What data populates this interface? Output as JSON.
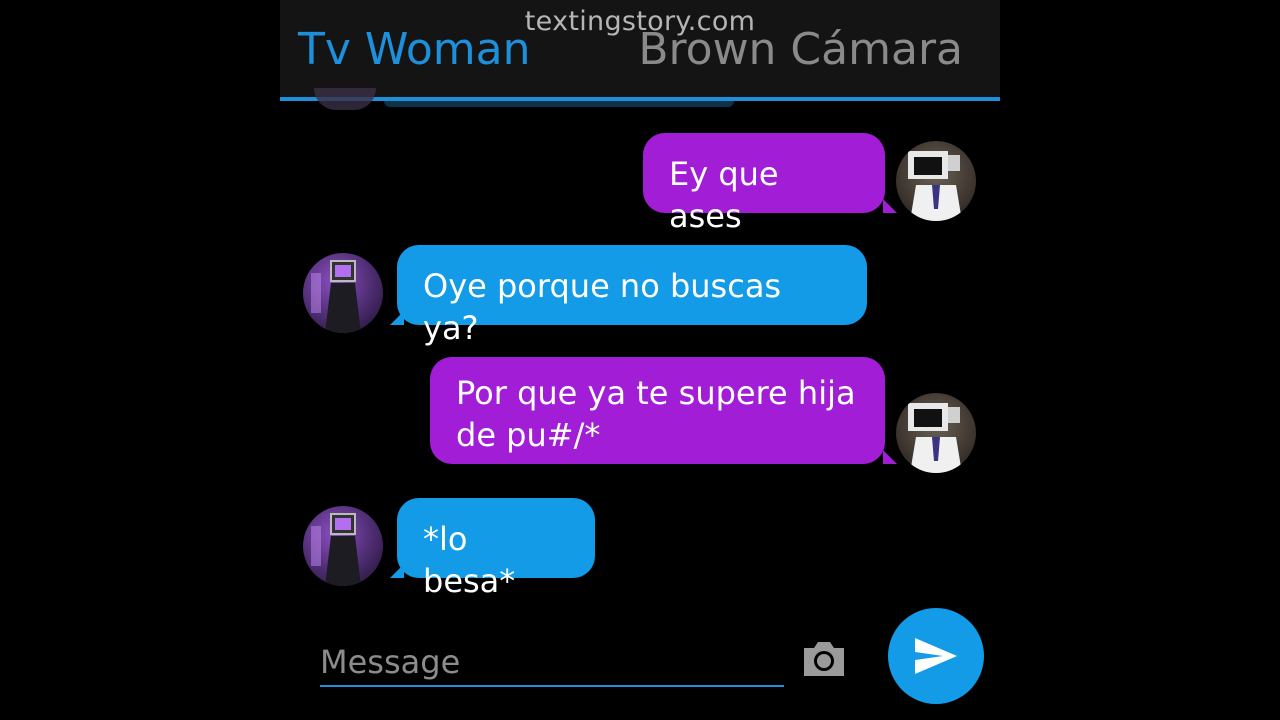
{
  "header": {
    "watermark": "textingstory.com",
    "contact_left": "Tv Woman",
    "contact_right": "Brown Cámara"
  },
  "messages": [
    {
      "side": "sent",
      "sender": "Brown Cámara",
      "text": "Ey que ases"
    },
    {
      "side": "recv",
      "sender": "Tv Woman",
      "text": "Oye porque no buscas ya?"
    },
    {
      "side": "sent",
      "sender": "Brown Cámara",
      "text": "Por que ya te supere hija de pu#/*"
    },
    {
      "side": "recv",
      "sender": "Tv Woman",
      "text": "*lo besa*"
    }
  ],
  "composer": {
    "placeholder": "Message",
    "camera_icon": "camera-icon",
    "send_icon": "send-icon"
  },
  "colors": {
    "accent": "#1e8fdb",
    "sent_bubble": "#a21ed6",
    "recv_bubble": "#139be8",
    "background": "#000000"
  }
}
